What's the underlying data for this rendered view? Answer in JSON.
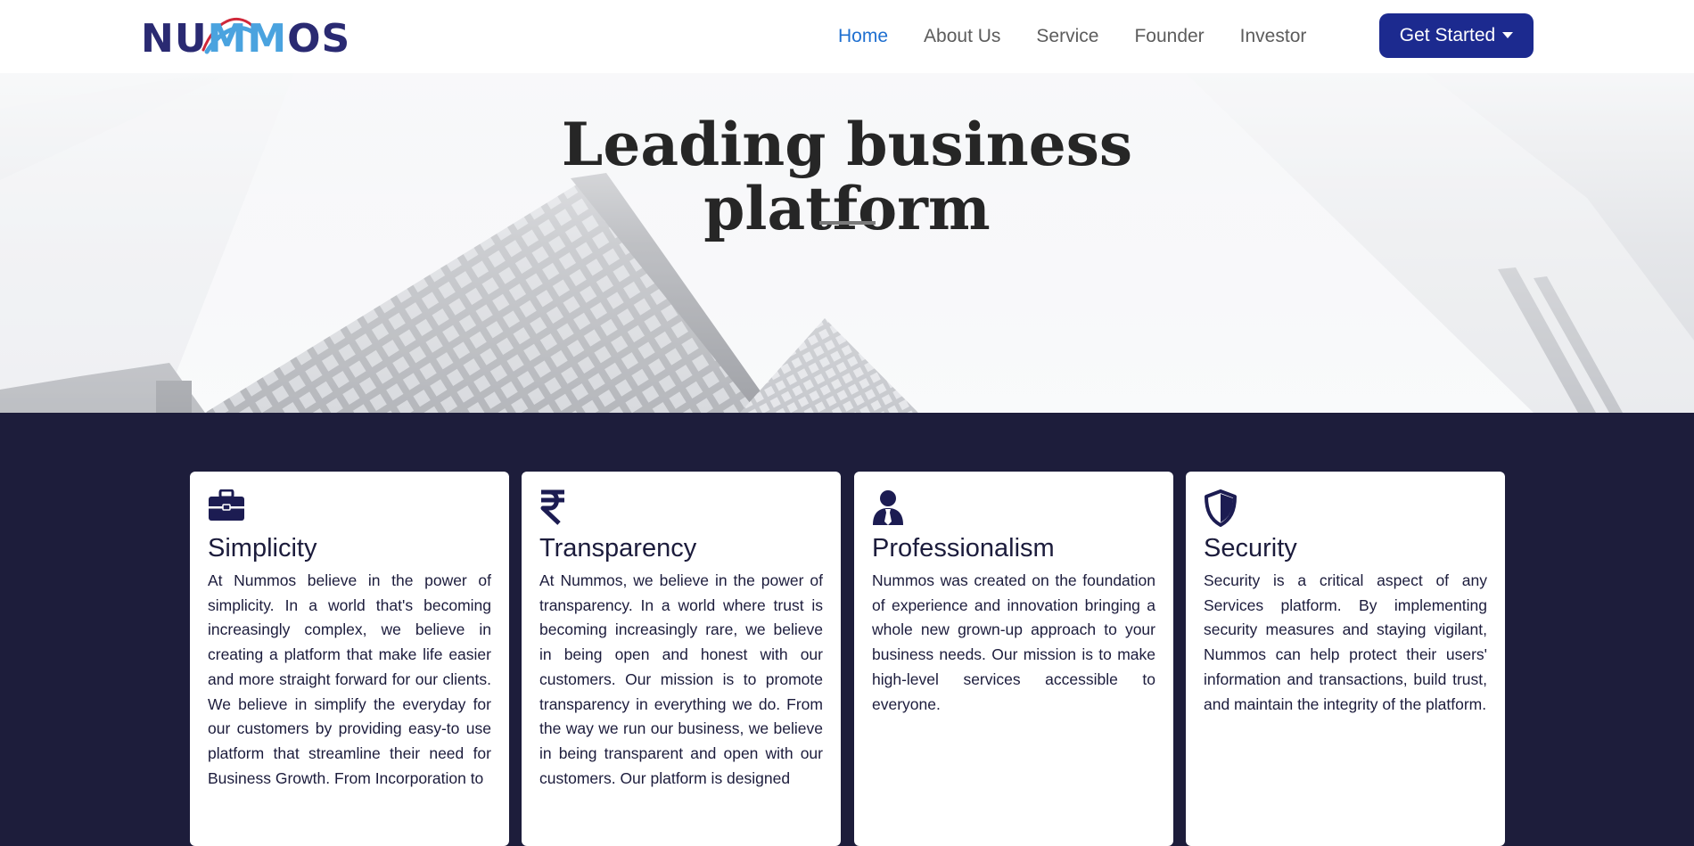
{
  "brand": {
    "logo_alt": "NUMMOS"
  },
  "nav": {
    "items": [
      {
        "label": "Home",
        "active": true
      },
      {
        "label": "About Us",
        "active": false
      },
      {
        "label": "Service",
        "active": false
      },
      {
        "label": "Founder",
        "active": false
      },
      {
        "label": "Investor",
        "active": false
      }
    ],
    "cta_label": "Get Started"
  },
  "hero": {
    "title_line1": "Leading business",
    "title_line2": "platform"
  },
  "features": [
    {
      "icon": "briefcase-icon",
      "title": "Simplicity",
      "text": "At Nummos believe in the power of simplicity. In a world that's becoming increasingly complex, we believe in creating a platform that make life easier and more straight forward for our clients. We believe in simplify the everyday for our customers by providing easy-to use platform that streamline their need for Business Growth. From Incorporation to"
    },
    {
      "icon": "rupee-icon",
      "title": "Transparency",
      "text": "At Nummos, we believe in the power of transparency. In a world where trust is becoming increasingly rare, we believe in being open and honest with our customers. Our mission is to promote transparency in everything we do. From the way we run our business, we believe in being transparent and open with our customers. Our platform is designed"
    },
    {
      "icon": "user-tie-icon",
      "title": "Professionalism",
      "text": "Nummos was created on the foundation of experience and innovation bringing a whole new grown-up approach to your business needs. Our mission is to make high-level services accessible to everyone."
    },
    {
      "icon": "shield-icon",
      "title": "Security",
      "text": "Security is a critical aspect of any Services platform. By implementing security measures and staying vigilant, Nummos can help protect their users' information and transactions, build trust, and maintain the integrity of the platform."
    }
  ],
  "colors": {
    "brand_navy": "#2a2a72",
    "brand_sky": "#4aa3df",
    "cta_bg": "#1c2a8f",
    "nav_active": "#1e6fd0",
    "section_bg": "#1d1d3b"
  }
}
